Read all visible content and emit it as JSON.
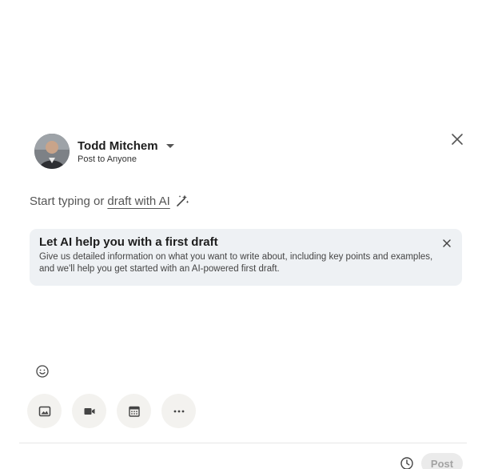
{
  "author": {
    "name": "Todd Mitchem",
    "audience": "Post to Anyone"
  },
  "editor": {
    "prompt_prefix": "Start typing or",
    "draft_link": "draft with AI"
  },
  "ai_card": {
    "title": "Let AI help you with a first draft",
    "body": "Give us detailed information on what you want to write about, including key points and examples, and we'll help you get started with an AI-powered first draft."
  },
  "toolbar": {
    "icons": [
      "emoji-icon",
      "image-icon",
      "video-icon",
      "calendar-icon",
      "more-icon"
    ]
  },
  "footer": {
    "post_label": "Post"
  },
  "colors": {
    "card_bg": "#eef1f4",
    "tool_bg": "#f3f2ef",
    "post_disabled_bg": "#ebebeb",
    "post_disabled_text": "#a3a3a3"
  }
}
